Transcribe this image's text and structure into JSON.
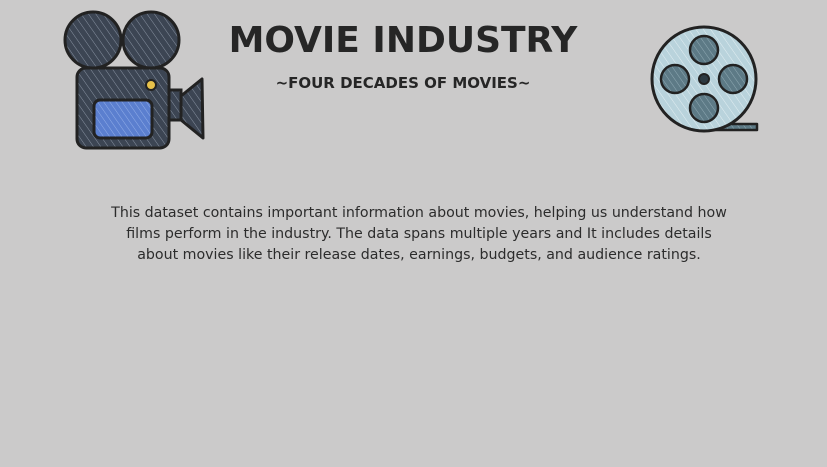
{
  "header": {
    "title": "MOVIE INDUSTRY",
    "subtitle": "~FOUR DECADES OF MOVIES~"
  },
  "description": {
    "text": "This dataset contains important information about movies, helping us understand how films perform in the industry. The data spans multiple years and It includes details about movies like their release dates, earnings, budgets, and audience ratings."
  },
  "icons": {
    "left": "movie-camera-icon",
    "right": "film-reel-icon"
  },
  "colors": {
    "background": "#cbcaca",
    "camera_body": "#3c4553",
    "camera_screen": "#5b7fcf",
    "camera_lens_light": "#e7c14a",
    "reel_face": "#b9d3dc",
    "reel_holes": "#5d7a86",
    "outline": "#222222"
  }
}
